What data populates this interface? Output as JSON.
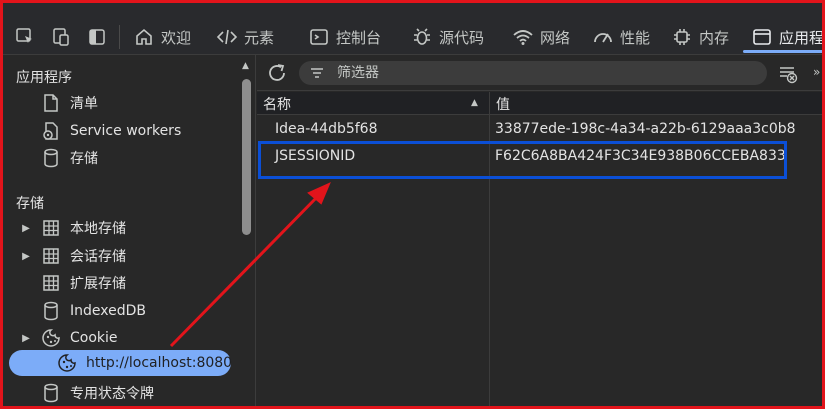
{
  "toolbar": {
    "tabs": [
      {
        "label": "欢迎",
        "icon": "home-icon"
      },
      {
        "label": "元素",
        "icon": "code-icon"
      },
      {
        "label": "控制台",
        "icon": "console-icon"
      },
      {
        "label": "源代码",
        "icon": "bug-icon"
      },
      {
        "label": "网络",
        "icon": "wifi-icon"
      },
      {
        "label": "性能",
        "icon": "gauge-icon"
      },
      {
        "label": "内存",
        "icon": "chip-icon"
      },
      {
        "label": "应用程",
        "icon": "window-icon"
      }
    ],
    "active_tab": "应用程"
  },
  "sidebar": {
    "section_app": "应用程序",
    "app_items": [
      "清单",
      "Service workers",
      "存储"
    ],
    "section_storage": "存储",
    "storage_items": [
      "本地存储",
      "会话存储",
      "扩展存储",
      "IndexedDB",
      "Cookie"
    ],
    "cookie_child": "http://localhost:8080",
    "private_token": "专用状态令牌"
  },
  "main": {
    "filter_placeholder": "筛选器",
    "columns": {
      "name": "名称",
      "value": "值"
    },
    "rows": [
      {
        "name": "Idea-44db5f68",
        "value": "33877ede-198c-4a34-a22b-6129aaa3c0b8"
      },
      {
        "name": "JSESSIONID",
        "value": "F62C6A8BA424F3C34E938B06CCEBA833"
      }
    ]
  },
  "colors": {
    "accent": "#7cacf8",
    "annotation_red": "#e2141b",
    "highlight_blue": "#0b4fd6"
  }
}
